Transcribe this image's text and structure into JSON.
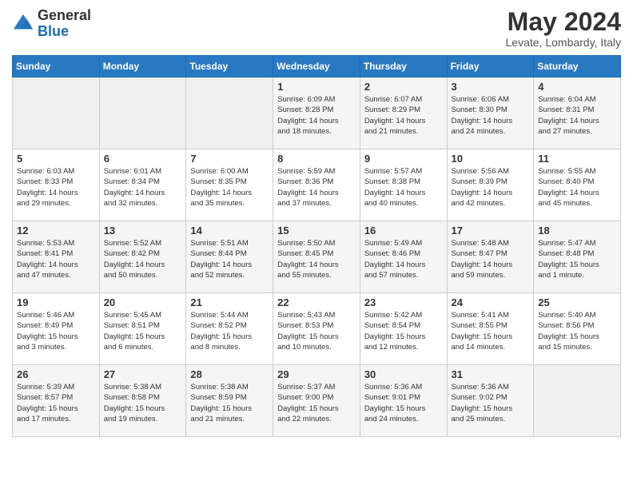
{
  "header": {
    "logo_general": "General",
    "logo_blue": "Blue",
    "title": "May 2024",
    "location": "Levate, Lombardy, Italy"
  },
  "days_of_week": [
    "Sunday",
    "Monday",
    "Tuesday",
    "Wednesday",
    "Thursday",
    "Friday",
    "Saturday"
  ],
  "weeks": [
    [
      {
        "day": "",
        "info": ""
      },
      {
        "day": "",
        "info": ""
      },
      {
        "day": "",
        "info": ""
      },
      {
        "day": "1",
        "info": "Sunrise: 6:09 AM\nSunset: 8:28 PM\nDaylight: 14 hours\nand 18 minutes."
      },
      {
        "day": "2",
        "info": "Sunrise: 6:07 AM\nSunset: 8:29 PM\nDaylight: 14 hours\nand 21 minutes."
      },
      {
        "day": "3",
        "info": "Sunrise: 6:06 AM\nSunset: 8:30 PM\nDaylight: 14 hours\nand 24 minutes."
      },
      {
        "day": "4",
        "info": "Sunrise: 6:04 AM\nSunset: 8:31 PM\nDaylight: 14 hours\nand 27 minutes."
      }
    ],
    [
      {
        "day": "5",
        "info": "Sunrise: 6:03 AM\nSunset: 8:33 PM\nDaylight: 14 hours\nand 29 minutes."
      },
      {
        "day": "6",
        "info": "Sunrise: 6:01 AM\nSunset: 8:34 PM\nDaylight: 14 hours\nand 32 minutes."
      },
      {
        "day": "7",
        "info": "Sunrise: 6:00 AM\nSunset: 8:35 PM\nDaylight: 14 hours\nand 35 minutes."
      },
      {
        "day": "8",
        "info": "Sunrise: 5:59 AM\nSunset: 8:36 PM\nDaylight: 14 hours\nand 37 minutes."
      },
      {
        "day": "9",
        "info": "Sunrise: 5:57 AM\nSunset: 8:38 PM\nDaylight: 14 hours\nand 40 minutes."
      },
      {
        "day": "10",
        "info": "Sunrise: 5:56 AM\nSunset: 8:39 PM\nDaylight: 14 hours\nand 42 minutes."
      },
      {
        "day": "11",
        "info": "Sunrise: 5:55 AM\nSunset: 8:40 PM\nDaylight: 14 hours\nand 45 minutes."
      }
    ],
    [
      {
        "day": "12",
        "info": "Sunrise: 5:53 AM\nSunset: 8:41 PM\nDaylight: 14 hours\nand 47 minutes."
      },
      {
        "day": "13",
        "info": "Sunrise: 5:52 AM\nSunset: 8:42 PM\nDaylight: 14 hours\nand 50 minutes."
      },
      {
        "day": "14",
        "info": "Sunrise: 5:51 AM\nSunset: 8:44 PM\nDaylight: 14 hours\nand 52 minutes."
      },
      {
        "day": "15",
        "info": "Sunrise: 5:50 AM\nSunset: 8:45 PM\nDaylight: 14 hours\nand 55 minutes."
      },
      {
        "day": "16",
        "info": "Sunrise: 5:49 AM\nSunset: 8:46 PM\nDaylight: 14 hours\nand 57 minutes."
      },
      {
        "day": "17",
        "info": "Sunrise: 5:48 AM\nSunset: 8:47 PM\nDaylight: 14 hours\nand 59 minutes."
      },
      {
        "day": "18",
        "info": "Sunrise: 5:47 AM\nSunset: 8:48 PM\nDaylight: 15 hours\nand 1 minute."
      }
    ],
    [
      {
        "day": "19",
        "info": "Sunrise: 5:46 AM\nSunset: 8:49 PM\nDaylight: 15 hours\nand 3 minutes."
      },
      {
        "day": "20",
        "info": "Sunrise: 5:45 AM\nSunset: 8:51 PM\nDaylight: 15 hours\nand 6 minutes."
      },
      {
        "day": "21",
        "info": "Sunrise: 5:44 AM\nSunset: 8:52 PM\nDaylight: 15 hours\nand 8 minutes."
      },
      {
        "day": "22",
        "info": "Sunrise: 5:43 AM\nSunset: 8:53 PM\nDaylight: 15 hours\nand 10 minutes."
      },
      {
        "day": "23",
        "info": "Sunrise: 5:42 AM\nSunset: 8:54 PM\nDaylight: 15 hours\nand 12 minutes."
      },
      {
        "day": "24",
        "info": "Sunrise: 5:41 AM\nSunset: 8:55 PM\nDaylight: 15 hours\nand 14 minutes."
      },
      {
        "day": "25",
        "info": "Sunrise: 5:40 AM\nSunset: 8:56 PM\nDaylight: 15 hours\nand 15 minutes."
      }
    ],
    [
      {
        "day": "26",
        "info": "Sunrise: 5:39 AM\nSunset: 8:57 PM\nDaylight: 15 hours\nand 17 minutes."
      },
      {
        "day": "27",
        "info": "Sunrise: 5:38 AM\nSunset: 8:58 PM\nDaylight: 15 hours\nand 19 minutes."
      },
      {
        "day": "28",
        "info": "Sunrise: 5:38 AM\nSunset: 8:59 PM\nDaylight: 15 hours\nand 21 minutes."
      },
      {
        "day": "29",
        "info": "Sunrise: 5:37 AM\nSunset: 9:00 PM\nDaylight: 15 hours\nand 22 minutes."
      },
      {
        "day": "30",
        "info": "Sunrise: 5:36 AM\nSunset: 9:01 PM\nDaylight: 15 hours\nand 24 minutes."
      },
      {
        "day": "31",
        "info": "Sunrise: 5:36 AM\nSunset: 9:02 PM\nDaylight: 15 hours\nand 25 minutes."
      },
      {
        "day": "",
        "info": ""
      }
    ]
  ]
}
